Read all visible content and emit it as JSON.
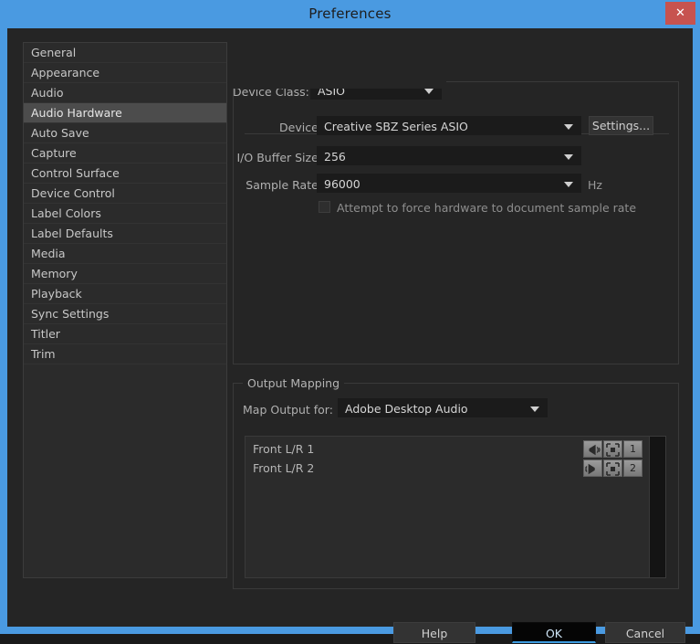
{
  "window": {
    "title": "Preferences",
    "close_label": "✕",
    "accent_blue": "#4a9ae1",
    "close_red": "#c7534f",
    "dialog_bg": "#252525"
  },
  "sidebar": {
    "items": [
      {
        "label": "General",
        "selected": false
      },
      {
        "label": "Appearance",
        "selected": false
      },
      {
        "label": "Audio",
        "selected": false
      },
      {
        "label": "Audio Hardware",
        "selected": true
      },
      {
        "label": "Auto Save",
        "selected": false
      },
      {
        "label": "Capture",
        "selected": false
      },
      {
        "label": "Control Surface",
        "selected": false
      },
      {
        "label": "Device Control",
        "selected": false
      },
      {
        "label": "Label Colors",
        "selected": false
      },
      {
        "label": "Label Defaults",
        "selected": false
      },
      {
        "label": "Media",
        "selected": false
      },
      {
        "label": "Memory",
        "selected": false
      },
      {
        "label": "Playback",
        "selected": false
      },
      {
        "label": "Sync Settings",
        "selected": false
      },
      {
        "label": "Titler",
        "selected": false
      },
      {
        "label": "Trim",
        "selected": false
      }
    ]
  },
  "device_panel": {
    "device_class": {
      "label": "Device Class:",
      "value": "ASIO"
    },
    "device": {
      "label": "Device:",
      "value": "Creative SBZ Series ASIO"
    },
    "settings_button": "Settings...",
    "buffer_size": {
      "label": "I/O Buffer Size:",
      "value": "256"
    },
    "sample_rate": {
      "label": "Sample Rate:",
      "value": "96000",
      "unit": "Hz"
    },
    "force_rate": {
      "label": "Attempt to force hardware to document sample rate",
      "checked": false
    }
  },
  "output_mapping": {
    "legend": "Output Mapping",
    "map_output_for": {
      "label": "Map Output for:",
      "value": "Adobe Desktop Audio"
    },
    "rows": [
      {
        "name": "Front L/R 1",
        "pan_icon": "speaker-left-icon",
        "clip_icon": "channel-bracket-icon",
        "channel": "1"
      },
      {
        "name": "Front L/R 2",
        "pan_icon": "speaker-right-icon",
        "clip_icon": "channel-bracket-icon",
        "channel": "2"
      }
    ]
  },
  "footer": {
    "help": "Help",
    "ok": "OK",
    "cancel": "Cancel"
  }
}
